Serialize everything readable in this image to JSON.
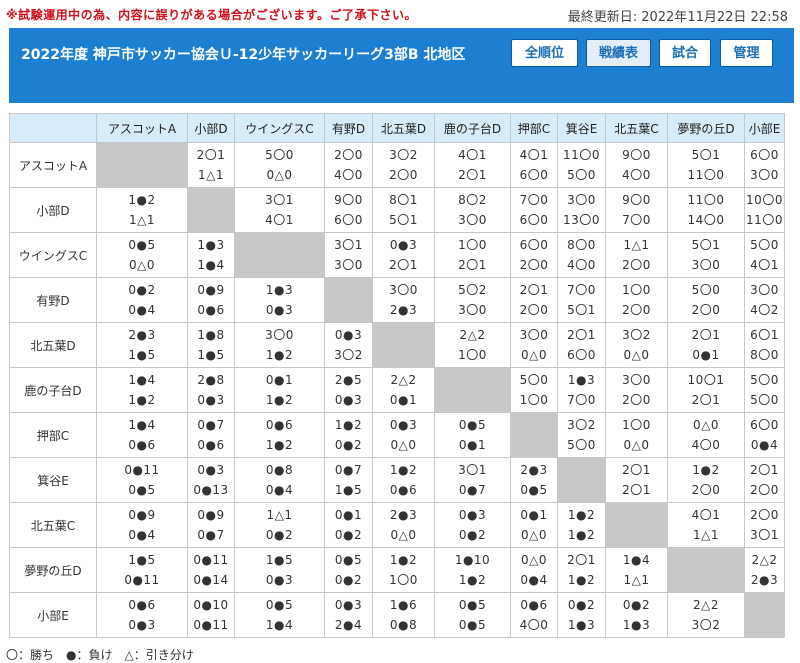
{
  "notice": "※試験運用中の為、内容に誤りがある場合がございます。ご了承下さい。",
  "updated": "最終更新日: 2022年11月22日 22:58",
  "banner": {
    "title": "2022年度 神戸市サッカー協会Ｕ-12少年サッカーリーグ3部B 北地区",
    "buttons": [
      "全順位",
      "戦績表",
      "試合",
      "管理"
    ]
  },
  "teams": [
    "アスコットA",
    "小部D",
    "ウイングスC",
    "有野D",
    "北五葉D",
    "鹿の子台D",
    "押部C",
    "箕谷E",
    "北五葉C",
    "夢野の丘D",
    "小部E"
  ],
  "results": [
    [
      null,
      [
        "2〇1",
        "1△1"
      ],
      [
        "5〇0",
        "0△0"
      ],
      [
        "2〇0",
        "4〇0"
      ],
      [
        "3〇2",
        "2〇0"
      ],
      [
        "4〇1",
        "2〇1"
      ],
      [
        "4〇1",
        "6〇0"
      ],
      [
        "11〇0",
        "5〇0"
      ],
      [
        "9〇0",
        "4〇0"
      ],
      [
        "5〇1",
        "11〇0"
      ],
      [
        "6〇0",
        "3〇0"
      ]
    ],
    [
      [
        "1●2",
        "1△1"
      ],
      null,
      [
        "3〇1",
        "4〇1"
      ],
      [
        "9〇0",
        "6〇0"
      ],
      [
        "8〇1",
        "5〇1"
      ],
      [
        "8〇2",
        "3〇0"
      ],
      [
        "7〇0",
        "6〇0"
      ],
      [
        "3〇0",
        "13〇0"
      ],
      [
        "9〇0",
        "7〇0"
      ],
      [
        "11〇0",
        "14〇0"
      ],
      [
        "10〇0",
        "11〇0"
      ]
    ],
    [
      [
        "0●5",
        "0△0"
      ],
      [
        "1●3",
        "1●4"
      ],
      null,
      [
        "3〇1",
        "3〇0"
      ],
      [
        "0●3",
        "2〇1"
      ],
      [
        "1〇0",
        "2〇1"
      ],
      [
        "6〇0",
        "2〇0"
      ],
      [
        "8〇0",
        "4〇0"
      ],
      [
        "1△1",
        "2〇0"
      ],
      [
        "5〇1",
        "3〇0"
      ],
      [
        "5〇0",
        "4〇1"
      ]
    ],
    [
      [
        "0●2",
        "0●4"
      ],
      [
        "0●9",
        "0●6"
      ],
      [
        "1●3",
        "0●3"
      ],
      null,
      [
        "3〇0",
        "2●3"
      ],
      [
        "5〇2",
        "3〇0"
      ],
      [
        "2〇1",
        "2〇0"
      ],
      [
        "7〇0",
        "5〇1"
      ],
      [
        "1〇0",
        "2〇0"
      ],
      [
        "5〇0",
        "2〇0"
      ],
      [
        "3〇0",
        "4〇2"
      ]
    ],
    [
      [
        "2●3",
        "1●5"
      ],
      [
        "1●8",
        "1●5"
      ],
      [
        "3〇0",
        "1●2"
      ],
      [
        "0●3",
        "3〇2"
      ],
      null,
      [
        "2△2",
        "1〇0"
      ],
      [
        "3〇0",
        "0△0"
      ],
      [
        "2〇1",
        "6〇0"
      ],
      [
        "3〇2",
        "0△0"
      ],
      [
        "2〇1",
        "0●1"
      ],
      [
        "6〇1",
        "8〇0"
      ]
    ],
    [
      [
        "1●4",
        "1●2"
      ],
      [
        "2●8",
        "0●3"
      ],
      [
        "0●1",
        "1●2"
      ],
      [
        "2●5",
        "0●3"
      ],
      [
        "2△2",
        "0●1"
      ],
      null,
      [
        "5〇0",
        "1〇0"
      ],
      [
        "1●3",
        "7〇0"
      ],
      [
        "3〇0",
        "2〇0"
      ],
      [
        "10〇1",
        "2〇1"
      ],
      [
        "5〇0",
        "5〇0"
      ]
    ],
    [
      [
        "1●4",
        "0●6"
      ],
      [
        "0●7",
        "0●6"
      ],
      [
        "0●6",
        "1●2"
      ],
      [
        "1●2",
        "0●2"
      ],
      [
        "0●3",
        "0△0"
      ],
      [
        "0●5",
        "0●1"
      ],
      null,
      [
        "3〇2",
        "5〇0"
      ],
      [
        "1〇0",
        "0△0"
      ],
      [
        "0△0",
        "4〇0"
      ],
      [
        "6〇0",
        "0●4"
      ]
    ],
    [
      [
        "0●11",
        "0●5"
      ],
      [
        "0●3",
        "0●13"
      ],
      [
        "0●8",
        "0●4"
      ],
      [
        "0●7",
        "1●5"
      ],
      [
        "1●2",
        "0●6"
      ],
      [
        "3〇1",
        "0●7"
      ],
      [
        "2●3",
        "0●5"
      ],
      null,
      [
        "2〇1",
        "2〇1"
      ],
      [
        "1●2",
        "2〇0"
      ],
      [
        "2〇1",
        "2〇0"
      ]
    ],
    [
      [
        "0●9",
        "0●4"
      ],
      [
        "0●9",
        "0●7"
      ],
      [
        "1△1",
        "0●2"
      ],
      [
        "0●1",
        "0●2"
      ],
      [
        "2●3",
        "0△0"
      ],
      [
        "0●3",
        "0●2"
      ],
      [
        "0●1",
        "0△0"
      ],
      [
        "1●2",
        "1●2"
      ],
      null,
      [
        "4〇1",
        "1△1"
      ],
      [
        "2〇0",
        "3〇1"
      ]
    ],
    [
      [
        "1●5",
        "0●11"
      ],
      [
        "0●11",
        "0●14"
      ],
      [
        "1●5",
        "0●3"
      ],
      [
        "0●5",
        "0●2"
      ],
      [
        "1●2",
        "1〇0"
      ],
      [
        "1●10",
        "1●2"
      ],
      [
        "0△0",
        "0●4"
      ],
      [
        "2〇1",
        "1●2"
      ],
      [
        "1●4",
        "1△1"
      ],
      null,
      [
        "2△2",
        "2●3"
      ]
    ],
    [
      [
        "0●6",
        "0●3"
      ],
      [
        "0●10",
        "0●11"
      ],
      [
        "0●5",
        "1●4"
      ],
      [
        "0●3",
        "2●4"
      ],
      [
        "1●6",
        "0●8"
      ],
      [
        "0●5",
        "0●5"
      ],
      [
        "0●6",
        "4〇0"
      ],
      [
        "0●2",
        "1●3"
      ],
      [
        "0●2",
        "1●3"
      ],
      [
        "2△2",
        "3〇2"
      ],
      null
    ]
  ],
  "legend": "〇：勝ち　●：負け　△：引き分け"
}
